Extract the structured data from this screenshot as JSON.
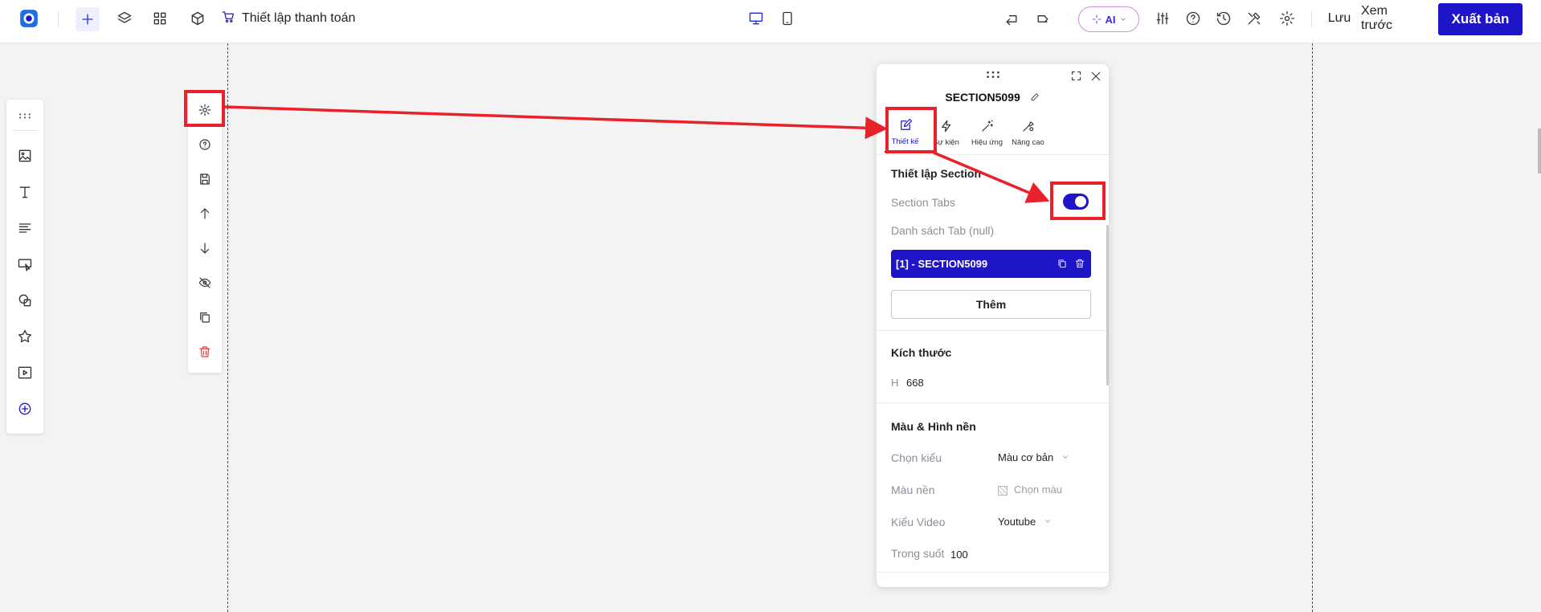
{
  "topbar": {
    "logo_icon": "app-logo-icon",
    "page_title": "Thiết lập thanh toán",
    "ai_label": "AI",
    "save_label": "Lưu",
    "preview_label": "Xem trước",
    "publish_label": "Xuất bản",
    "accent": "#1e15c9"
  },
  "left_toolbar": {
    "items": [
      "drag-handle-icon",
      "image-icon",
      "text-icon",
      "paragraph-icon",
      "button-icon",
      "shapes-icon",
      "star-icon",
      "video-icon",
      "add-circle-icon"
    ]
  },
  "section_toolbar": {
    "items": [
      "settings-icon",
      "help-icon",
      "save-icon",
      "move-up-icon",
      "move-down-icon",
      "hide-icon",
      "duplicate-icon",
      "delete-icon"
    ]
  },
  "panel": {
    "title": "SECTION5099",
    "tabs": [
      {
        "label": "Thiết kế",
        "icon": "edit-icon",
        "active": true
      },
      {
        "label": "Sự kiện",
        "icon": "lightning-icon",
        "active": false
      },
      {
        "label": "Hiệu ứng",
        "icon": "magic-wand-icon",
        "active": false
      },
      {
        "label": "Nâng cao",
        "icon": "advanced-settings-icon",
        "active": false
      }
    ],
    "section_settings": {
      "heading": "Thiết lập Section",
      "section_tabs_label": "Section Tabs",
      "section_tabs_enabled": true,
      "tab_list_label": "Danh sách Tab (null)",
      "tab_items": [
        "[1] - SECTION5099"
      ],
      "add_button": "Thêm"
    },
    "size": {
      "heading": "Kích thước",
      "h_label": "H",
      "h_value": "668"
    },
    "background": {
      "heading": "Màu & Hình nền",
      "style_label": "Chọn kiểu",
      "style_value": "Màu cơ bản",
      "color_label": "Màu nền",
      "color_placeholder": "Chọn màu",
      "video_label": "Kiểu Video",
      "video_value": "Youtube",
      "opacity_label": "Trong suốt",
      "opacity_value": "100"
    }
  },
  "annotations": {
    "color": "#e8212a"
  }
}
